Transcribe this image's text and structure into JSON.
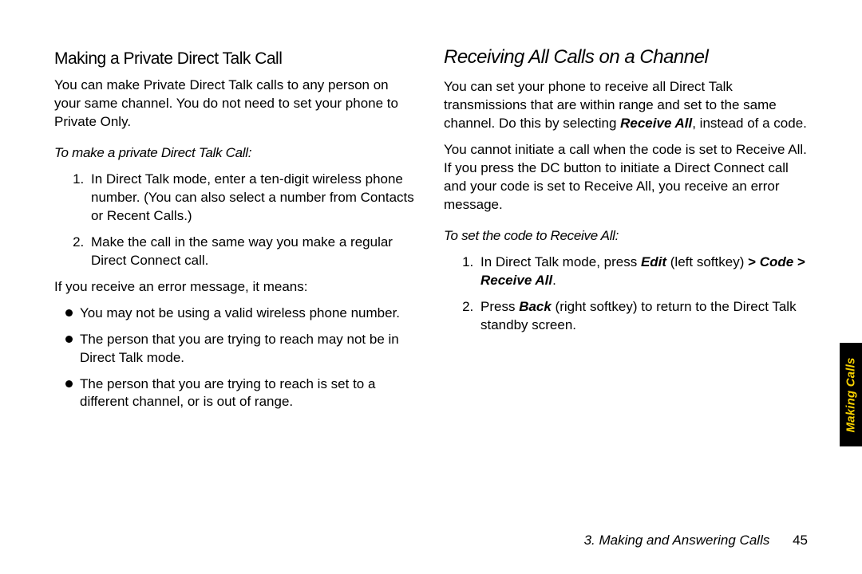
{
  "left": {
    "heading": "Making a Private Direct Talk Call",
    "intro": "You can make Private Direct Talk calls to any person on your same channel. You do not need to set your phone to Private Only.",
    "lead": "To make a private Direct Talk Call:",
    "step1": "In Direct Talk mode, enter a ten-digit wireless phone number. (You can also select a number from Contacts or Recent Calls.)",
    "step2": "Make the call in the same way you make a regular Direct Connect call.",
    "err_intro": "If you receive an error message, it means:",
    "b1": "You may not be using a valid wireless phone number.",
    "b2": "The person that you are trying to reach may not be in Direct Talk mode.",
    "b3": "The person that you are trying to reach is set to a different channel, or is out of range."
  },
  "right": {
    "heading": "Receiving All Calls on a Channel",
    "p1a": "You can set your phone to receive all Direct Talk transmissions that are within range and set to the same channel. Do this by selecting ",
    "p1b": "Receive All",
    "p1c": ", instead of a code.",
    "p2": "You cannot initiate a call when the code is set to Receive All. If you press the DC button to initiate a Direct Connect call and your code is set to Receive All, you receive an error message.",
    "lead": "To set the code to Receive All:",
    "s1a": "In Direct Talk mode, press ",
    "s1b": "Edit",
    "s1c": " (left softkey) ",
    "s1_gt1": ">",
    "s1d": " Code ",
    "s1_gt2": ">",
    "s1e": " Receive All",
    "s1f": ".",
    "s2a": "Press ",
    "s2b": "Back",
    "s2c": " (right softkey) to return to the Direct Talk standby screen."
  },
  "footer": {
    "chapter": "3. Making and Answering Calls",
    "page": "45"
  },
  "tab": "Making Calls"
}
